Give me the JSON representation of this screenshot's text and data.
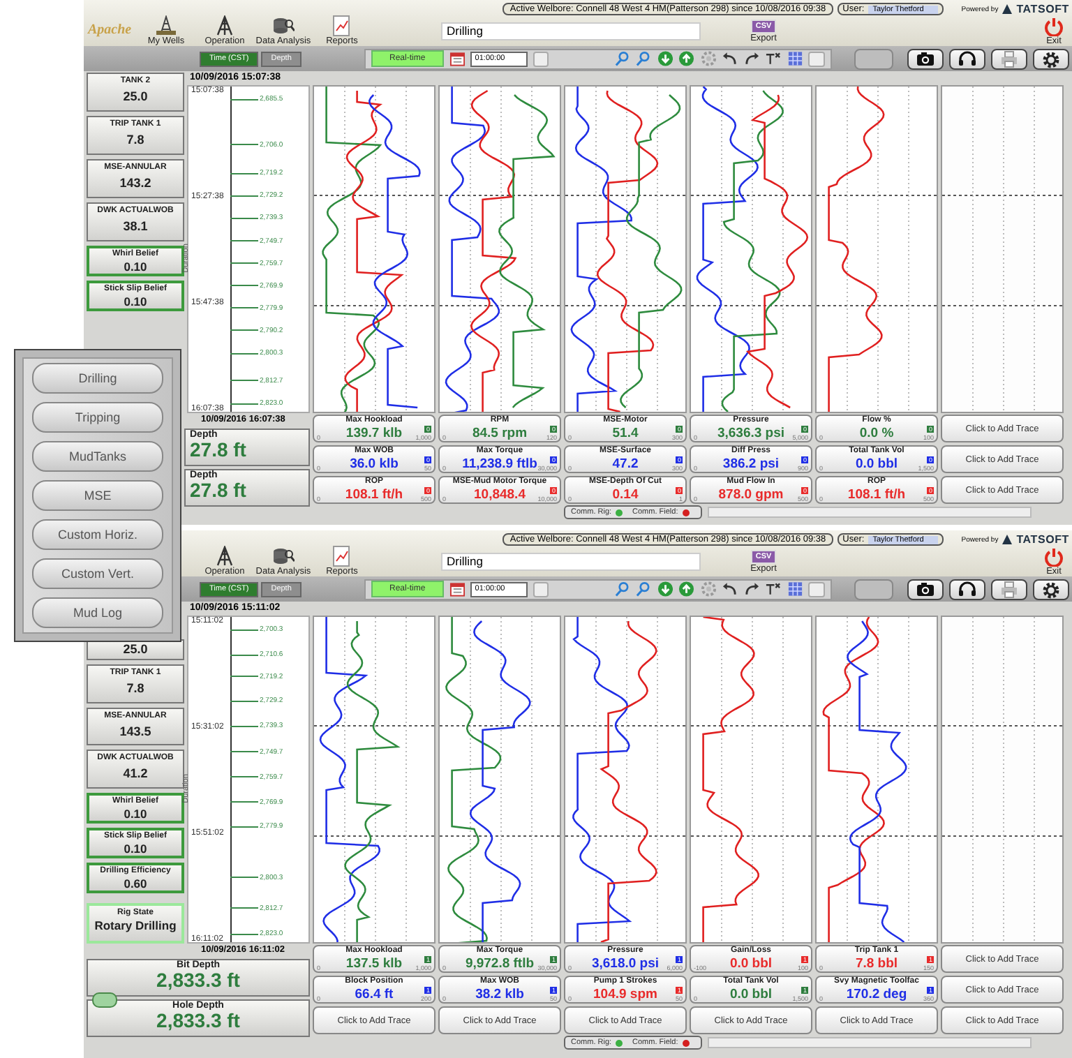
{
  "windows": [
    {
      "header": {
        "logo": "Apache",
        "nav": [
          {
            "label": "My Wells",
            "kind": "rig"
          },
          {
            "label": "Operation",
            "kind": "derrick"
          },
          {
            "label": "Data Analysis",
            "kind": "analysis"
          },
          {
            "label": "Reports",
            "kind": "report"
          }
        ],
        "view": "Drilling",
        "welbore": "Active Welbore: Connell 48 West 4 HM(Patterson 298) since 10/08/2016 09:38",
        "user_label": "User:",
        "user": "Taylor Thetford",
        "powered_by": "Powered by",
        "brand": "TATSOFT",
        "export_badge": "CSV",
        "export": "Export",
        "exit": "Exit"
      },
      "toolbar": {
        "modes": [
          {
            "label": "Time (CST)",
            "selected": true
          },
          {
            "label": "Depth",
            "selected": false
          }
        ],
        "live": "Real-time",
        "range": "01:00:00"
      },
      "side_cards": [
        {
          "kind": "value",
          "title": "TANK 2",
          "value": "25.0"
        },
        {
          "kind": "value",
          "title": "TRIP TANK 1",
          "value": "7.8"
        },
        {
          "kind": "value",
          "title": "MSE-ANNULAR",
          "value": "143.2"
        },
        {
          "kind": "value",
          "title": "DWK ACTUALWOB",
          "value": "38.1"
        },
        {
          "kind": "belief",
          "title": "Whirl Belief",
          "value": "0.10"
        },
        {
          "kind": "belief",
          "title": "Stick Slip Belief",
          "value": "0.10"
        }
      ],
      "axis": {
        "start": "10/09/2016 15:07:38",
        "end": "10/09/2016 16:07:38",
        "label": "Duration",
        "times": [
          "15:07:38",
          "15:27:38",
          "15:47:38",
          "16:07:38"
        ],
        "depths": [
          "2,685.5",
          "2,706.0",
          "2,719.2",
          "2,729.2",
          "2,739.3",
          "2,749.7",
          "2,759.7",
          "2,769.9",
          "2,779.9",
          "2,790.2",
          "2,800.3",
          "2,812.7",
          "2,823.0"
        ]
      },
      "tracks": [
        {
          "traces": [
            {
              "color": "#2e8b3e"
            },
            {
              "color": "#e02020"
            },
            {
              "color": "#1f2ee6"
            }
          ]
        },
        {
          "traces": [
            {
              "color": "#1f2ee6"
            },
            {
              "color": "#e02020"
            },
            {
              "color": "#2e8b3e"
            }
          ]
        },
        {
          "traces": [
            {
              "color": "#1f2ee6"
            },
            {
              "color": "#e02020"
            },
            {
              "color": "#2e8b3e"
            }
          ]
        },
        {
          "traces": [
            {
              "color": "#1f2ee6"
            },
            {
              "color": "#2e8b3e"
            },
            {
              "color": "#e02020"
            }
          ]
        },
        {
          "traces": [
            {
              "color": "#e02020"
            }
          ]
        },
        {
          "kind": "blank"
        }
      ],
      "depth_cards": [
        {
          "kind": "partial",
          "title": "Depth",
          "value": "27.8 ft"
        },
        {
          "kind": "partial",
          "title": "Depth",
          "value": "27.8 ft"
        }
      ],
      "gauges": [
        [
          {
            "kind": "reading",
            "title": "Max Hookload",
            "value": "139.7 klb",
            "min": "0",
            "max": "1,000",
            "badge": "0",
            "color": "#2e7d3e"
          },
          {
            "kind": "reading",
            "title": "Max WOB",
            "value": "36.0 klb",
            "min": "0",
            "max": "50",
            "badge": "0",
            "color": "#1f2ee6"
          },
          {
            "kind": "reading",
            "title": "ROP",
            "value": "108.1 ft/h",
            "min": "0",
            "max": "500",
            "badge": "0",
            "color": "#e82b2b"
          }
        ],
        [
          {
            "kind": "reading",
            "title": "RPM",
            "value": "84.5 rpm",
            "min": "0",
            "max": "120",
            "badge": "0",
            "color": "#2e7d3e"
          },
          {
            "kind": "reading",
            "title": "Max Torque",
            "value": "11,238.9 ftlb",
            "min": "0",
            "max": "30,000",
            "badge": "0",
            "color": "#1f2ee6"
          },
          {
            "kind": "reading",
            "title": "MSE-Mud Motor Torque",
            "value": "10,848.4",
            "min": "0",
            "max": "10,000",
            "badge": "0",
            "color": "#e82b2b"
          }
        ],
        [
          {
            "kind": "reading",
            "title": "MSE-Motor",
            "value": "51.4",
            "min": "0",
            "max": "300",
            "badge": "0",
            "color": "#2e7d3e"
          },
          {
            "kind": "reading",
            "title": "MSE-Surface",
            "value": "47.2",
            "min": "0",
            "max": "300",
            "badge": "0",
            "color": "#1f2ee6"
          },
          {
            "kind": "reading",
            "title": "MSE-Depth Of Cut",
            "value": "0.14",
            "min": "0",
            "max": "1",
            "badge": "0",
            "color": "#e82b2b"
          }
        ],
        [
          {
            "kind": "reading",
            "title": "Pressure",
            "value": "3,636.3 psi",
            "min": "0",
            "max": "5,000",
            "badge": "0",
            "color": "#2e7d3e"
          },
          {
            "kind": "reading",
            "title": "Diff Press",
            "value": "386.2 psi",
            "min": "0",
            "max": "900",
            "badge": "0",
            "color": "#1f2ee6"
          },
          {
            "kind": "reading",
            "title": "Mud Flow In",
            "value": "878.0 gpm",
            "min": "0",
            "max": "500",
            "badge": "0",
            "color": "#e82b2b"
          }
        ],
        [
          {
            "kind": "reading",
            "title": "Flow %",
            "value": "0.0 %",
            "min": "0",
            "max": "100",
            "badge": "0",
            "color": "#2e7d3e"
          },
          {
            "kind": "reading",
            "title": "Total Tank Vol",
            "value": "0.0 bbl",
            "min": "0",
            "max": "1,500",
            "badge": "0",
            "color": "#1f2ee6"
          },
          {
            "kind": "reading",
            "title": "ROP",
            "value": "108.1 ft/h",
            "min": "0",
            "max": "500",
            "badge": "0",
            "color": "#e82b2b"
          }
        ],
        [
          {
            "kind": "empty",
            "label": "Click to Add Trace"
          },
          {
            "kind": "empty",
            "label": "Click to Add Trace"
          },
          {
            "kind": "empty",
            "label": "Click to Add Trace"
          }
        ]
      ],
      "status": {
        "links": [
          {
            "label": "Comm. Rig:",
            "color": "#3cb043"
          },
          {
            "label": "Comm. Field:",
            "color": "#d42020"
          }
        ]
      }
    },
    {
      "header": {
        "nav": [
          {
            "label": "Operation",
            "kind": "derrick"
          },
          {
            "label": "Data Analysis",
            "kind": "analysis"
          },
          {
            "label": "Reports",
            "kind": "report"
          }
        ],
        "view": "Drilling",
        "welbore": "Active Welbore: Connell 48 West 4 HM(Patterson 298) since 10/08/2016 09:38",
        "user_label": "User:",
        "user": "Taylor Thetford",
        "powered_by": "Powered by",
        "brand": "TATSOFT",
        "export_badge": "CSV",
        "export": "Export",
        "exit": "Exit"
      },
      "toolbar": {
        "modes": [
          {
            "label": "Time (CST)",
            "selected": true
          },
          {
            "label": "Depth",
            "selected": false
          }
        ],
        "live": "Real-time",
        "range": "01:00:00"
      },
      "side_cards": [
        {
          "kind": "partial",
          "value": "25.0"
        },
        {
          "kind": "value",
          "title": "TRIP TANK 1",
          "value": "7.8"
        },
        {
          "kind": "value",
          "title": "MSE-ANNULAR",
          "value": "143.5"
        },
        {
          "kind": "value",
          "title": "DWK ACTUALWOB",
          "value": "41.2"
        },
        {
          "kind": "belief",
          "title": "Whirl Belief",
          "value": "0.10"
        },
        {
          "kind": "belief",
          "title": "Stick Slip Belief",
          "value": "0.10"
        },
        {
          "kind": "belief",
          "title": "Drilling Efficiency",
          "value": "0.60"
        },
        {
          "kind": "state",
          "title": "Rig State",
          "value": "Rotary Drilling"
        }
      ],
      "axis": {
        "start": "10/09/2016 15:11:02",
        "end": "10/09/2016 16:11:02",
        "label": "Duration",
        "times": [
          "15:11:02",
          "15:31:02",
          "15:51:02",
          "16:11:02"
        ],
        "depths": [
          "2,700.3",
          "2,710.6",
          "2,719.2",
          "2,729.2",
          "2,739.3",
          "2,749.7",
          "2,759.7",
          "2,769.9",
          "2,779.9",
          "2,800.3",
          "2,812.7",
          "2,823.0"
        ]
      },
      "tracks": [
        {
          "traces": [
            {
              "color": "#1f2ee6"
            },
            {
              "color": "#2e8b3e"
            }
          ]
        },
        {
          "traces": [
            {
              "color": "#2e8b3e"
            },
            {
              "color": "#1f2ee6"
            }
          ]
        },
        {
          "traces": [
            {
              "color": "#1f2ee6"
            },
            {
              "color": "#e02020"
            }
          ]
        },
        {
          "traces": [
            {
              "color": "#e02020"
            }
          ]
        },
        {
          "traces": [
            {
              "color": "#e02020"
            },
            {
              "color": "#1f2ee6"
            }
          ]
        },
        {
          "kind": "blank"
        }
      ],
      "depth_cards": [
        {
          "kind": "full",
          "title": "Bit Depth",
          "value": "2,833.3 ft"
        },
        {
          "kind": "full",
          "title": "Hole Depth",
          "value": "2,833.3 ft"
        }
      ],
      "splitter_handle": true,
      "gauges": [
        [
          {
            "kind": "reading",
            "title": "Max Hookload",
            "value": "137.5 klb",
            "min": "0",
            "max": "1,000",
            "badge": "1",
            "color": "#2e7d3e"
          },
          {
            "kind": "reading",
            "title": "Block Position",
            "value": "66.4 ft",
            "min": "0",
            "max": "200",
            "badge": "1",
            "color": "#1f2ee6"
          },
          {
            "kind": "empty",
            "label": "Click to Add Trace"
          }
        ],
        [
          {
            "kind": "reading",
            "title": "Max Torque",
            "value": "9,972.8 ftlb",
            "min": "0",
            "max": "30,000",
            "badge": "1",
            "color": "#2e7d3e"
          },
          {
            "kind": "reading",
            "title": "Max WOB",
            "value": "38.2 klb",
            "min": "0",
            "max": "50",
            "badge": "1",
            "color": "#1f2ee6"
          },
          {
            "kind": "empty",
            "label": "Click to Add Trace"
          }
        ],
        [
          {
            "kind": "reading",
            "title": "Pressure",
            "value": "3,618.0 psi",
            "min": "0",
            "max": "6,000",
            "badge": "1",
            "color": "#1f2ee6"
          },
          {
            "kind": "reading",
            "title": "Pump 1 Strokes",
            "value": "104.9 spm",
            "min": "0",
            "max": "50",
            "badge": "1",
            "color": "#e82b2b"
          },
          {
            "kind": "empty",
            "label": "Click to Add Trace"
          }
        ],
        [
          {
            "kind": "reading",
            "title": "Gain/Loss",
            "value": "0.0 bbl",
            "min": "-100",
            "max": "100",
            "badge": "1",
            "color": "#e82b2b"
          },
          {
            "kind": "reading",
            "title": "Total Tank Vol",
            "value": "0.0 bbl",
            "min": "0",
            "max": "1,500",
            "badge": "1",
            "color": "#2e7d3e"
          },
          {
            "kind": "empty",
            "label": "Click to Add Trace"
          }
        ],
        [
          {
            "kind": "reading",
            "title": "Trip Tank 1",
            "value": "7.8 bbl",
            "min": "0",
            "max": "150",
            "badge": "1",
            "color": "#e82b2b"
          },
          {
            "kind": "reading",
            "title": "Svy Magnetic Toolfac",
            "value": "170.2 deg",
            "min": "0",
            "max": "360",
            "badge": "1",
            "color": "#1f2ee6"
          },
          {
            "kind": "empty",
            "label": "Click to Add Trace"
          }
        ],
        [
          {
            "kind": "empty",
            "label": "Click to Add Trace"
          },
          {
            "kind": "empty",
            "label": "Click to Add Trace"
          },
          {
            "kind": "empty",
            "label": "Click to Add Trace"
          }
        ]
      ],
      "status": {
        "links": [
          {
            "label": "Comm. Rig:",
            "color": "#3cb043"
          },
          {
            "label": "Comm. Field:",
            "color": "#d42020"
          }
        ]
      }
    }
  ],
  "menu": {
    "items": [
      "Drilling",
      "Tripping",
      "MudTanks",
      "MSE",
      "Custom Horiz.",
      "Custom Vert.",
      "Mud Log"
    ]
  }
}
